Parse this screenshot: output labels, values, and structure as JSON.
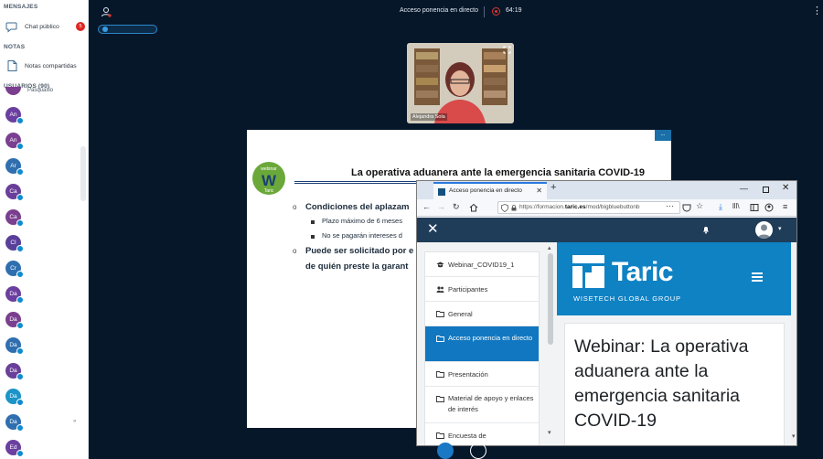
{
  "sidebar": {
    "messages_title": "MENSAJES",
    "public_chat_label": "Chat público",
    "public_chat_badge": "5",
    "notes_title": "NOTAS",
    "shared_notes_label": "Notas compartidas",
    "users_title": "USUARIOS (90)",
    "first_user_name": "Pasquasio",
    "users": [
      {
        "initials": "An",
        "color": "#6b3fa0"
      },
      {
        "initials": "An",
        "color": "#7a3f8f"
      },
      {
        "initials": "Ar",
        "color": "#2f6fb0"
      },
      {
        "initials": "Ca",
        "color": "#6a3f9a"
      },
      {
        "initials": "Ca",
        "color": "#7a3f8f"
      },
      {
        "initials": "Cl",
        "color": "#5a3f9a"
      },
      {
        "initials": "Cr",
        "color": "#2f6fb0"
      },
      {
        "initials": "Da",
        "color": "#6b3fa0"
      },
      {
        "initials": "Da",
        "color": "#7a3f8f"
      },
      {
        "initials": "Da",
        "color": "#2f6fb0"
      },
      {
        "initials": "Da",
        "color": "#6a3f9a"
      },
      {
        "initials": "Da",
        "color": "#1b94c8"
      },
      {
        "initials": "Da",
        "color": "#2f6fb0"
      },
      {
        "initials": "Ed",
        "color": "#6b3fa0"
      }
    ]
  },
  "topbar": {
    "meeting_title": "Acceso ponencia en directo",
    "recording_time": "64:19"
  },
  "webcam": {
    "presenter_name": "Alejandra Sola"
  },
  "slide": {
    "logo_top": "webinar",
    "logo_letter": "W",
    "logo_bottom": "Taric",
    "title": "La operativa aduanera ante la emergencia sanitaria COVID-19",
    "line1": "Condiciones del aplazam",
    "line2": "Plazo máximo de 6 meses",
    "line3": "No se pagarán intereses d",
    "line4": "Puede ser solicitado por e",
    "line5": "de quién preste la garant"
  },
  "browser": {
    "tab_title": "Acceso ponencia en directo",
    "url_prefix": "https://formacion.",
    "url_domain": "taric.es",
    "url_suffix": "/mod/bigbluebuttonb",
    "colors": {
      "accent": "#1177c0",
      "appbar": "#1f3d59",
      "brand": "#0f82c4"
    }
  },
  "course_nav": {
    "items": [
      {
        "label": "Webinar_COVID19_1",
        "icon": "graduation-cap-icon"
      },
      {
        "label": "Participantes",
        "icon": "users-icon"
      },
      {
        "label": "General",
        "icon": "folder-icon"
      },
      {
        "label": "Acceso ponencia en directo",
        "icon": "folder-icon",
        "active": true
      },
      {
        "label": "Presentación",
        "icon": "folder-icon"
      },
      {
        "label": "Material de apoyo y enlaces de interés",
        "icon": "folder-icon"
      },
      {
        "label": "Encuesta de",
        "icon": "folder-icon"
      }
    ]
  },
  "brand": {
    "name": "Taric",
    "subtitle": "WISETECH GLOBAL GROUP"
  },
  "page": {
    "title": "Webinar: La operativa aduanera ante la emergencia sanitaria COVID-19"
  }
}
